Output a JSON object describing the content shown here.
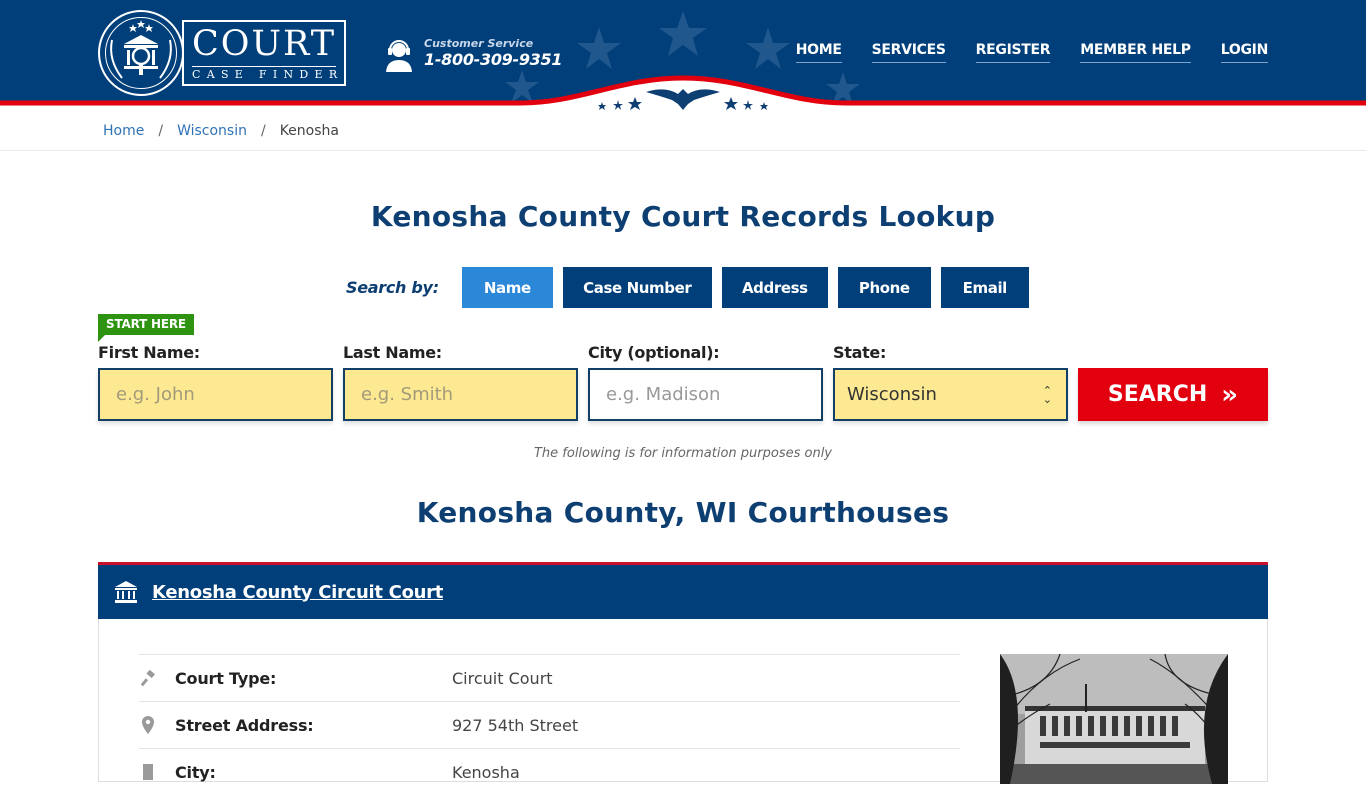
{
  "header": {
    "logo_title": "COURT",
    "logo_subtitle": "CASE FINDER",
    "customer_service_label": "Customer Service",
    "customer_service_phone": "1-800-309-9351",
    "nav": [
      {
        "label": "HOME"
      },
      {
        "label": "SERVICES"
      },
      {
        "label": "REGISTER"
      },
      {
        "label": "MEMBER HELP"
      },
      {
        "label": "LOGIN"
      }
    ],
    "colors": {
      "navy": "#003f7a",
      "red": "#e2000f"
    }
  },
  "breadcrumb": {
    "items": [
      {
        "label": "Home"
      },
      {
        "label": "Wisconsin"
      },
      {
        "label": "Kenosha"
      }
    ],
    "separator": "/"
  },
  "page_title": "Kenosha County Court Records Lookup",
  "search": {
    "search_by_label": "Search by:",
    "tabs": [
      {
        "label": "Name",
        "active": true
      },
      {
        "label": "Case Number",
        "active": false
      },
      {
        "label": "Address",
        "active": false
      },
      {
        "label": "Phone",
        "active": false
      },
      {
        "label": "Email",
        "active": false
      }
    ],
    "start_here_badge": "START HERE",
    "fields": {
      "first_name": {
        "label": "First Name:",
        "placeholder": "e.g. John",
        "value": ""
      },
      "last_name": {
        "label": "Last Name:",
        "placeholder": "e.g. Smith",
        "value": ""
      },
      "city": {
        "label": "City (optional):",
        "placeholder": "e.g.  Madison",
        "value": ""
      },
      "state": {
        "label": "State:",
        "selected": "Wisconsin"
      }
    },
    "submit_label": "SEARCH",
    "submit_icon": "double-chevron-right"
  },
  "disclaimer": "The following is for information purposes only",
  "courthouses_heading": "Kenosha County, WI Courthouses",
  "courthouse": {
    "name": "Kenosha County Circuit Court",
    "icon": "courthouse-icon",
    "details": [
      {
        "icon": "gavel-icon",
        "label": "Court Type:",
        "value": "Circuit Court"
      },
      {
        "icon": "map-pin-icon",
        "label": "Street Address:",
        "value": "927 54th Street"
      },
      {
        "icon": "building-icon",
        "label": "City:",
        "value": "Kenosha"
      }
    ],
    "photo_alt": "Kenosha County courthouse photo"
  }
}
